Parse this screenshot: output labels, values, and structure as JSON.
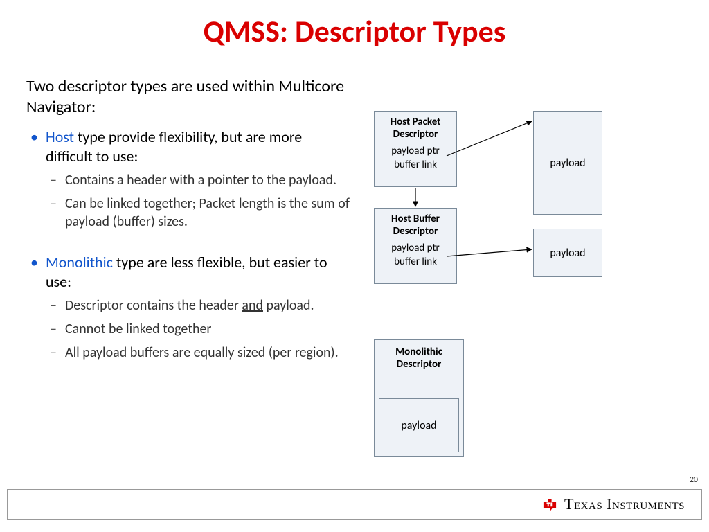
{
  "title": "QMSS: Descriptor Types",
  "lead": "Two descriptor types are used within Multicore Navigator:",
  "bullets": [
    {
      "keyword": "Host",
      "rest": " type provide flexibility, but are more difficult to use:",
      "subs": [
        "Contains a header with a pointer to the payload.",
        "Can be linked together; Packet length is the sum of payload (buffer) sizes."
      ]
    },
    {
      "keyword": "Monolithic",
      "rest": " type are less flexible, but easier to use:",
      "subs": [
        "Descriptor contains the header <u>and</u> payload.",
        "Cannot be linked together",
        "All payload buffers are equally sized (per region)."
      ]
    }
  ],
  "diagram": {
    "hpd": {
      "title": "Host Packet Descriptor",
      "line1": "payload ptr",
      "line2": "buffer link"
    },
    "hbd": {
      "title": "Host Buffer Descriptor",
      "line1": "payload ptr",
      "line2": "buffer link"
    },
    "payload": "payload",
    "mono": {
      "title": "Monolithic Descriptor",
      "payload": "payload"
    }
  },
  "footer": {
    "brand": "Texas Instruments"
  },
  "page": "20"
}
